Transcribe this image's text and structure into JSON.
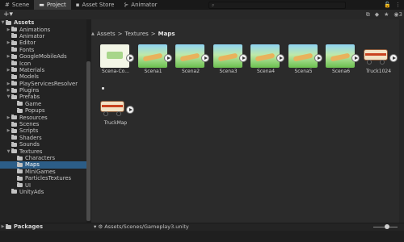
{
  "tabs": [
    {
      "icon": "grid-icon",
      "label": "Scene"
    },
    {
      "icon": "folder-icon",
      "label": "Project"
    },
    {
      "icon": "store-icon",
      "label": "Asset Store"
    },
    {
      "icon": "animator-icon",
      "label": "Animator"
    }
  ],
  "toolbar": {
    "add_label": "+▾",
    "search_placeholder": "⌕",
    "hidden_count": "3"
  },
  "tree": [
    {
      "label": "Assets",
      "depth": 0,
      "expanded": true,
      "bold": true
    },
    {
      "label": "Animations",
      "depth": 1,
      "expanded": false
    },
    {
      "label": "Animator",
      "depth": 1
    },
    {
      "label": "Editor",
      "depth": 1,
      "expanded": false
    },
    {
      "label": "Fonts",
      "depth": 1
    },
    {
      "label": "GoogleMobileAds",
      "depth": 1,
      "expanded": false
    },
    {
      "label": "Icon",
      "depth": 1
    },
    {
      "label": "Materials",
      "depth": 1,
      "expanded": false
    },
    {
      "label": "Models",
      "depth": 1
    },
    {
      "label": "PlayServicesResolver",
      "depth": 1,
      "expanded": false
    },
    {
      "label": "Plugins",
      "depth": 1,
      "expanded": false
    },
    {
      "label": "Prefabs",
      "depth": 1,
      "expanded": true
    },
    {
      "label": "Game",
      "depth": 2
    },
    {
      "label": "Popups",
      "depth": 2
    },
    {
      "label": "Resources",
      "depth": 1,
      "expanded": false
    },
    {
      "label": "Scenes",
      "depth": 1
    },
    {
      "label": "Scripts",
      "depth": 1,
      "expanded": false
    },
    {
      "label": "Shaders",
      "depth": 1
    },
    {
      "label": "Sounds",
      "depth": 1
    },
    {
      "label": "Textures",
      "depth": 1,
      "expanded": true
    },
    {
      "label": "Characters",
      "depth": 2
    },
    {
      "label": "Maps",
      "depth": 2,
      "selected": true
    },
    {
      "label": "MiniGames",
      "depth": 2
    },
    {
      "label": "ParticlesTextures",
      "depth": 2
    },
    {
      "label": "UI",
      "depth": 2
    },
    {
      "label": "UnityAds",
      "depth": 1
    }
  ],
  "packages_label": "Packages",
  "breadcrumb": {
    "parts": [
      "Assets",
      "Textures"
    ],
    "current": "Maps",
    "separator": ">"
  },
  "assets": [
    {
      "label": "Scena-Co...",
      "kind": "title"
    },
    {
      "label": "Scena1",
      "kind": "scene"
    },
    {
      "label": "Scena2",
      "kind": "scene"
    },
    {
      "label": "Scena3",
      "kind": "scene"
    },
    {
      "label": "Scena4",
      "kind": "scene"
    },
    {
      "label": "Scena5",
      "kind": "scene"
    },
    {
      "label": "Scena6",
      "kind": "scene"
    },
    {
      "label": "Truck1024",
      "kind": "truck"
    },
    {
      "label": "TruckMap",
      "kind": "truck"
    }
  ],
  "status": {
    "path": "Assets/Scenes/Gameplay3.unity"
  },
  "colors": {
    "selection": "#2c5d87",
    "panel": "#2b2b2b",
    "tabbar": "#191919"
  }
}
